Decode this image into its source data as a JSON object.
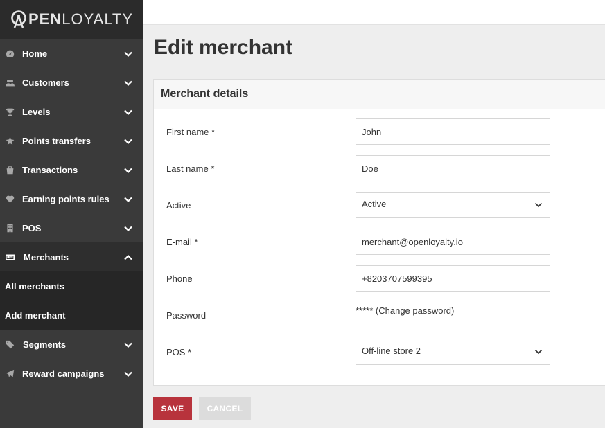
{
  "logo": {
    "brand_bold": "PEN",
    "brand_light": "LOYALTY"
  },
  "sidebar": {
    "items": [
      {
        "label": "Home",
        "icon": "dashboard-icon"
      },
      {
        "label": "Customers",
        "icon": "users-icon"
      },
      {
        "label": "Levels",
        "icon": "trophy-icon"
      },
      {
        "label": "Points transfers",
        "icon": "star-icon"
      },
      {
        "label": "Transactions",
        "icon": "shopping-bag-icon"
      },
      {
        "label": "Earning points rules",
        "icon": "heart-icon"
      },
      {
        "label": "POS",
        "icon": "building-icon"
      },
      {
        "label": "Merchants",
        "icon": "id-card-icon"
      },
      {
        "label": "Segments",
        "icon": "tags-icon"
      },
      {
        "label": "Reward campaigns",
        "icon": "paper-plane-icon"
      }
    ],
    "merchants_sub": [
      "All merchants",
      "Add merchant"
    ]
  },
  "page": {
    "title": "Edit merchant"
  },
  "form": {
    "header": "Merchant details",
    "first_name": {
      "label": "First name *",
      "value": "John"
    },
    "last_name": {
      "label": "Last name *",
      "value": "Doe"
    },
    "active": {
      "label": "Active",
      "value": "Active"
    },
    "email": {
      "label": "E-mail *",
      "value": "merchant@openloyalty.io"
    },
    "phone": {
      "label": "Phone",
      "value": "+8203707599395"
    },
    "password": {
      "label": "Password",
      "value": "*****",
      "link": "(Change password)"
    },
    "pos": {
      "label": "POS *",
      "value": "Off-line store 2"
    }
  },
  "actions": {
    "save": "SAVE",
    "cancel": "CANCEL"
  },
  "colors": {
    "sidebar": "#3a3a3a",
    "accent": "#b8333c",
    "disabled": "#dcdcdc"
  }
}
